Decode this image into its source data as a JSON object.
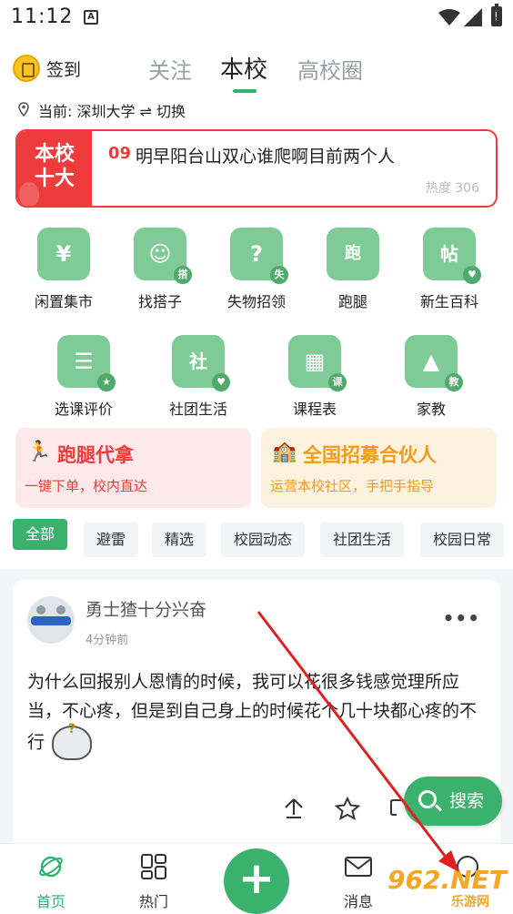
{
  "status": {
    "time": "11:12",
    "notif_glyph": "A",
    "battery_glyph": "!"
  },
  "header": {
    "signin": "签到",
    "tabs": [
      "关注",
      "本校",
      "高校圈"
    ],
    "location": "当前: 深圳大学 ⇌ 切换"
  },
  "hot": {
    "badge": "本校十大",
    "num": "09",
    "text": "明早阳台山双心谁爬啊目前两个人",
    "heat": "热度 306"
  },
  "grid": [
    {
      "label": "闲置集市",
      "glyph": "¥",
      "sub": ""
    },
    {
      "label": "找搭子",
      "glyph": "☺",
      "sub": "搭"
    },
    {
      "label": "失物招领",
      "glyph": "?",
      "sub": "失"
    },
    {
      "label": "跑腿",
      "glyph": "跑",
      "sub": ""
    },
    {
      "label": "新生百科",
      "glyph": "帖",
      "sub": "♥"
    },
    {
      "label": "选课评价",
      "glyph": "☰",
      "sub": "★"
    },
    {
      "label": "社团生活",
      "glyph": "社",
      "sub": "♥"
    },
    {
      "label": "课程表",
      "glyph": "▦",
      "sub": "课"
    },
    {
      "label": "家教",
      "glyph": "▲",
      "sub": "教"
    }
  ],
  "promos": [
    {
      "icon": "🏃",
      "title": "跑腿代拿",
      "sub": "一键下单，校内直达"
    },
    {
      "icon": "🏫",
      "title": "全国招募合伙人",
      "sub": "运营本校社区，手把手指导"
    }
  ],
  "chips": [
    "全部",
    "避雷",
    "精选",
    "校园动态",
    "社团生活",
    "校园日常"
  ],
  "post": {
    "user": "勇士猹十分兴奋",
    "time": "4分钟前",
    "more": "•••",
    "content": "为什么回报别人恩情的时候，我可以花很多钱感觉理所应当，不心疼，但是到自己身上的时候花个几十块都心疼的不行"
  },
  "fab": {
    "search": "搜索"
  },
  "nav": {
    "home": "首页",
    "hot": "热门",
    "plus": "+",
    "messages": "消息"
  },
  "watermark": {
    "main": "962.NET",
    "sub": "乐游网"
  }
}
